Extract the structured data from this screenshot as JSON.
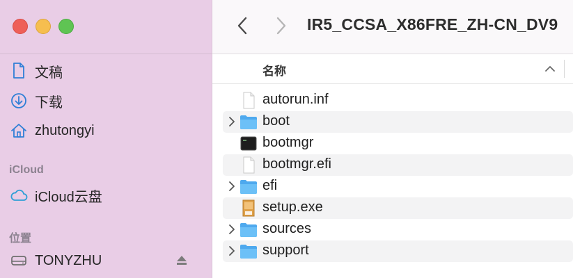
{
  "sidebar": {
    "items_top": [
      {
        "label": "文稿",
        "icon": "document-icon"
      },
      {
        "label": "下载",
        "icon": "download-icon"
      },
      {
        "label": "zhutongyi",
        "icon": "home-icon"
      }
    ],
    "icloud_header": "iCloud",
    "icloud_item": {
      "label": "iCloud云盘",
      "icon": "cloud-icon"
    },
    "locations_header": "位置",
    "location_item": {
      "label": "TONYZHU",
      "icon": "drive-icon"
    }
  },
  "toolbar": {
    "title": "IR5_CCSA_X86FRE_ZH-CN_DV9"
  },
  "columns": {
    "name": "名称"
  },
  "files": [
    {
      "name": "autorun.inf",
      "kind": "document",
      "expandable": false
    },
    {
      "name": "boot",
      "kind": "folder",
      "expandable": true
    },
    {
      "name": "bootmgr",
      "kind": "executable",
      "expandable": false
    },
    {
      "name": "bootmgr.efi",
      "kind": "document",
      "expandable": false
    },
    {
      "name": "efi",
      "kind": "folder",
      "expandable": true
    },
    {
      "name": "setup.exe",
      "kind": "exe",
      "expandable": false
    },
    {
      "name": "sources",
      "kind": "folder",
      "expandable": true
    },
    {
      "name": "support",
      "kind": "folder",
      "expandable": true
    }
  ],
  "colors": {
    "sidebar_bg": "#e9cde6",
    "folder": "#5fb4f0",
    "accent_icon": "#2f7fd6"
  }
}
